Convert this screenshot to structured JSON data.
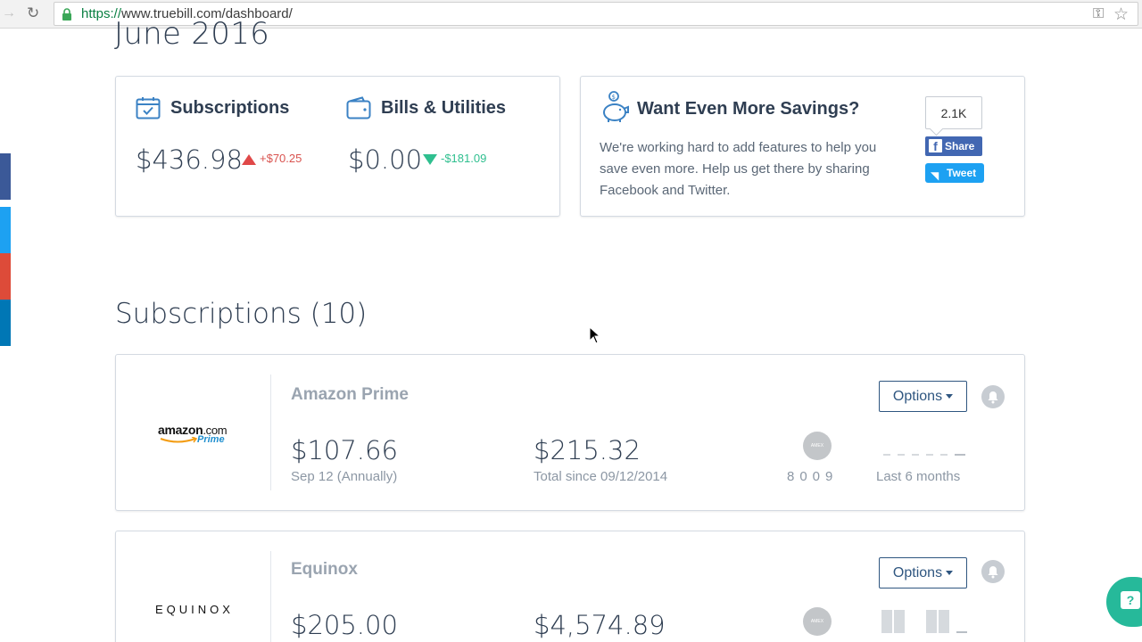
{
  "browser": {
    "url_scheme": "https://",
    "url_rest": "www.truebill.com/dashboard/"
  },
  "summary": {
    "month_title": "June 2016",
    "subscriptions": {
      "label": "Subscriptions",
      "amount": "$436.98",
      "delta": "+$70.25",
      "delta_direction": "up"
    },
    "bills": {
      "label": "Bills & Utilities",
      "amount": "$0.00",
      "delta": "-$181.09",
      "delta_direction": "down"
    }
  },
  "savings": {
    "title": "Want Even More Savings?",
    "text": "We're working hard to add features to help you save even more. Help us get there by sharing Facebook and Twitter.",
    "share_count": "2.1K",
    "facebook_label": "Share",
    "twitter_label": "Tweet"
  },
  "subscriptions_section": {
    "title": "Subscriptions (10)",
    "items": [
      {
        "name": "Amazon Prime",
        "logo_text_main": "amazon",
        "logo_text_com": ".com",
        "logo_text_sub": "Prime",
        "price": "$107.66",
        "next_date": "Sep 12 (Annually)",
        "total": "$215.32",
        "total_since": "Total since 09/12/2014",
        "card_digits": "8009",
        "history_label": "Last 6 months",
        "options_label": "Options"
      },
      {
        "name": "Equinox",
        "logo_text_main": "EQUINOX",
        "price": "$205.00",
        "total": "$4,574.89",
        "options_label": "Options"
      }
    ]
  },
  "colors": {
    "accent": "#2f5680",
    "up": "#e04848",
    "down": "#2fbf8f",
    "facebook": "#4267b2",
    "twitter": "#1da1f2",
    "chat": "#26b99a"
  }
}
